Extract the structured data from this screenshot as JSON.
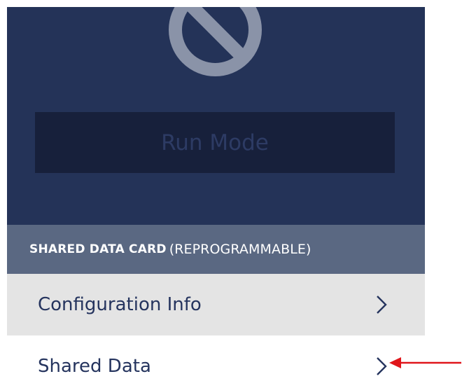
{
  "hero": {
    "icon": "no-entry-icon",
    "run_mode_label": "Run Mode",
    "colors": {
      "background": "#243358",
      "button": "#17203b",
      "button_text": "#2d3b64",
      "icon": "#8a93a8"
    }
  },
  "section": {
    "title_bold": "SHARED DATA CARD",
    "title_light": "(REPROGRAMMABLE)",
    "color": "#5a6882"
  },
  "rows": [
    {
      "label": "Configuration Info",
      "icon": "chevron-right-icon"
    },
    {
      "label": "Shared Data",
      "icon": "chevron-right-icon"
    }
  ],
  "annotation": {
    "icon": "arrow-left-icon",
    "color": "#e0161b"
  }
}
